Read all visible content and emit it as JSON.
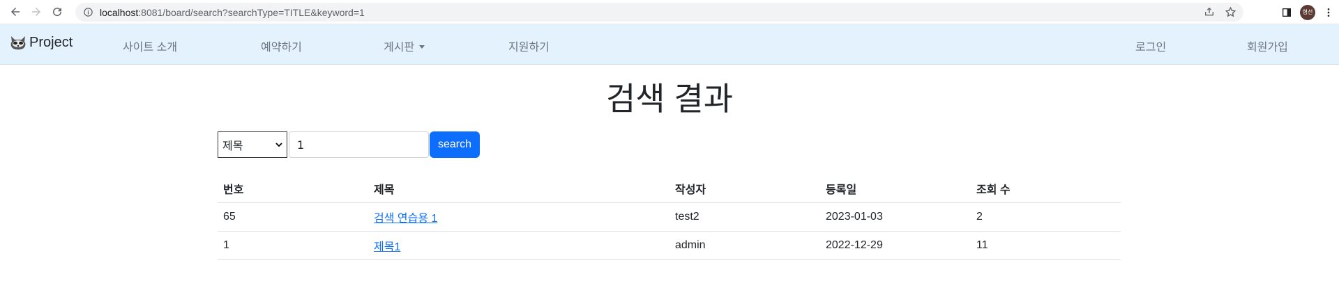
{
  "browser": {
    "url_host": "localhost",
    "url_path": ":8081/board/search?searchType=TITLE&keyword=1",
    "profile_initials": "형선"
  },
  "navbar": {
    "brand": "Project",
    "items": [
      {
        "label": "사이트 소개"
      },
      {
        "label": "예약하기"
      },
      {
        "label": "게시판"
      },
      {
        "label": "지원하기"
      }
    ],
    "login": "로그인",
    "signup": "회원가입"
  },
  "page": {
    "title": "검색 결과"
  },
  "search": {
    "type_selected": "제목",
    "keyword_value": "1",
    "button_label": "search"
  },
  "table": {
    "headers": [
      "번호",
      "제목",
      "작성자",
      "등록일",
      "조회 수"
    ],
    "rows": [
      [
        "65",
        "검색 연습용 1",
        "test2",
        "2023-01-03",
        "2"
      ],
      [
        "1",
        "제목1",
        "admin",
        "2022-12-29",
        "11"
      ]
    ]
  },
  "colors": {
    "navbar_bg": "#e3f2fd",
    "primary": "#0d6efd"
  }
}
